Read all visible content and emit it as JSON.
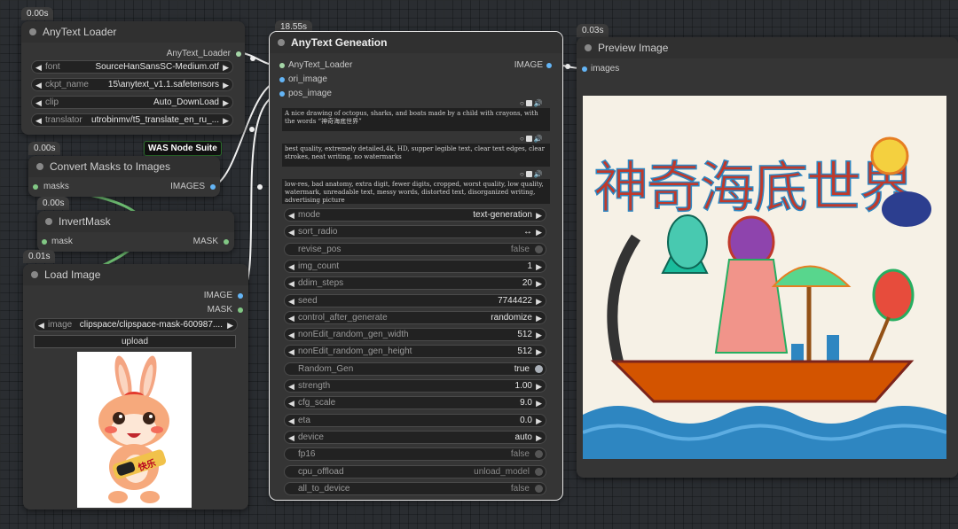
{
  "anytext_loader": {
    "time": "0.00s",
    "title": "AnyText Loader",
    "output": "AnyText_Loader",
    "widgets": [
      {
        "label": "font",
        "value": "SourceHanSansSC-Medium.otf"
      },
      {
        "label": "ckpt_name",
        "value": "15\\anytext_v1.1.safetensors"
      },
      {
        "label": "clip",
        "value": "Auto_DownLoad"
      },
      {
        "label": "translator",
        "value": "utrobinmv/t5_translate_en_ru_..."
      }
    ]
  },
  "convert_masks": {
    "time": "0.00s",
    "suite": "WAS Node Suite",
    "title": "Convert Masks to Images",
    "input": "masks",
    "output": "IMAGES"
  },
  "invert_mask": {
    "time": "0.00s",
    "title": "InvertMask",
    "input": "mask",
    "output": "MASK"
  },
  "load_image": {
    "time": "0.01s",
    "title": "Load Image",
    "outputs": [
      "IMAGE",
      "MASK"
    ],
    "image_label": "image",
    "image_value": "clipspace/clipspace-mask-600987....",
    "upload": "upload",
    "sticker_text": "快乐"
  },
  "anytext_gen": {
    "time": "18.55s",
    "title": "AnyText Geneation",
    "inputs": [
      "AnyText_Loader",
      "ori_image",
      "pos_image"
    ],
    "output": "IMAGE",
    "prompt": "A nice drawing of octopus, sharks, and boats made by a child with crayons, with the words “神奇海底世界”",
    "a_prompt": "best quality, extremely detailed,4k, HD, supper legible text,  clear text edges,  clear strokes, neat writing, no watermarks",
    "n_prompt": "low-res, bad anatomy, extra digit, fewer digits, cropped, worst quality, low quality, watermark, unreadable text, messy words, distorted text, disorganized writing, advertising picture",
    "widgets": [
      {
        "label": "mode",
        "value": "text-generation",
        "kind": "combo"
      },
      {
        "label": "sort_radio",
        "value": "↔",
        "kind": "combo"
      },
      {
        "label": "revise_pos",
        "value": "false",
        "kind": "toggle"
      },
      {
        "label": "img_count",
        "value": "1",
        "kind": "combo"
      },
      {
        "label": "ddim_steps",
        "value": "20",
        "kind": "combo"
      },
      {
        "label": "seed",
        "value": "7744422",
        "kind": "combo"
      },
      {
        "label": "control_after_generate",
        "value": "randomize",
        "kind": "combo"
      },
      {
        "label": "nonEdit_random_gen_width",
        "value": "512",
        "kind": "combo"
      },
      {
        "label": "nonEdit_random_gen_height",
        "value": "512",
        "kind": "combo"
      },
      {
        "label": "Random_Gen",
        "value": "true",
        "kind": "toggle-on"
      },
      {
        "label": "strength",
        "value": "1.00",
        "kind": "combo"
      },
      {
        "label": "cfg_scale",
        "value": "9.0",
        "kind": "combo"
      },
      {
        "label": "eta",
        "value": "0.0",
        "kind": "combo"
      },
      {
        "label": "device",
        "value": "auto",
        "kind": "combo"
      },
      {
        "label": "fp16",
        "value": "false",
        "kind": "toggle"
      },
      {
        "label": "cpu_offload",
        "value": "unload_model",
        "kind": "toggle"
      },
      {
        "label": "all_to_device",
        "value": "false",
        "kind": "toggle"
      }
    ]
  },
  "preview": {
    "time": "0.03s",
    "title": "Preview Image",
    "input": "images",
    "painting_text": "神奇海底世界"
  },
  "colors": {
    "image_socket": "#64b5f6",
    "mask_socket": "#81c784",
    "loader_socket": "#a5d6a7",
    "link": "#f0f0f0",
    "mask_link": "#6fbf73"
  }
}
